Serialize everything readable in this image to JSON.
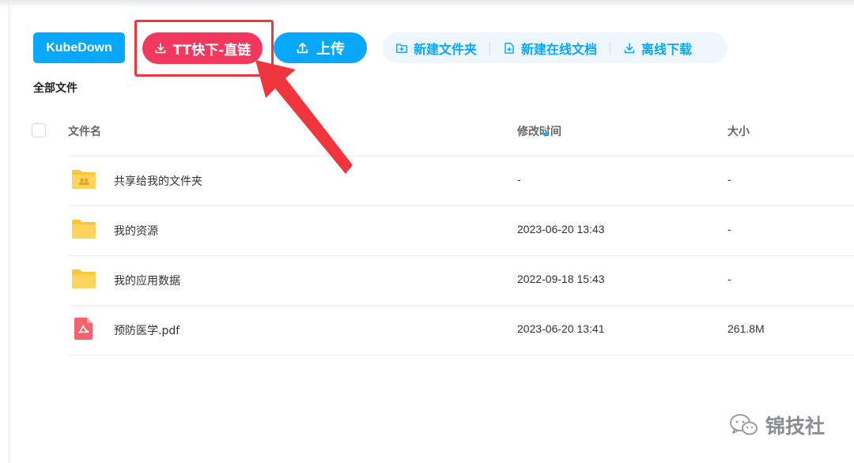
{
  "toolbar": {
    "kube_label": "KubeDown",
    "tt_label": "TT快下-直链",
    "upload_label": "上传",
    "actions": [
      {
        "label": "新建文件夹"
      },
      {
        "label": "新建在线文档"
      },
      {
        "label": "离线下载"
      }
    ]
  },
  "breadcrumb": {
    "label": "全部文件"
  },
  "table": {
    "headers": {
      "name": "文件名",
      "time": "修改时间",
      "size": "大小"
    },
    "rows": [
      {
        "icon": "shared-folder-icon",
        "name": "共享给我的文件夹",
        "time": "-",
        "size": "-"
      },
      {
        "icon": "folder-icon",
        "name": "我的资源",
        "time": "2023-06-20 13:43",
        "size": "-"
      },
      {
        "icon": "folder-icon",
        "name": "我的应用数据",
        "time": "2022-09-18 15:43",
        "size": "-"
      },
      {
        "icon": "pdf-file-icon",
        "name": "预防医学.pdf",
        "time": "2023-06-20 13:41",
        "size": "261.8M"
      }
    ]
  },
  "watermark": {
    "label": "锦技社"
  },
  "colors": {
    "primary": "#06a7ff",
    "tt_button": "#f3385f",
    "annotation": "#f0353f",
    "folder": "#ffc533"
  }
}
